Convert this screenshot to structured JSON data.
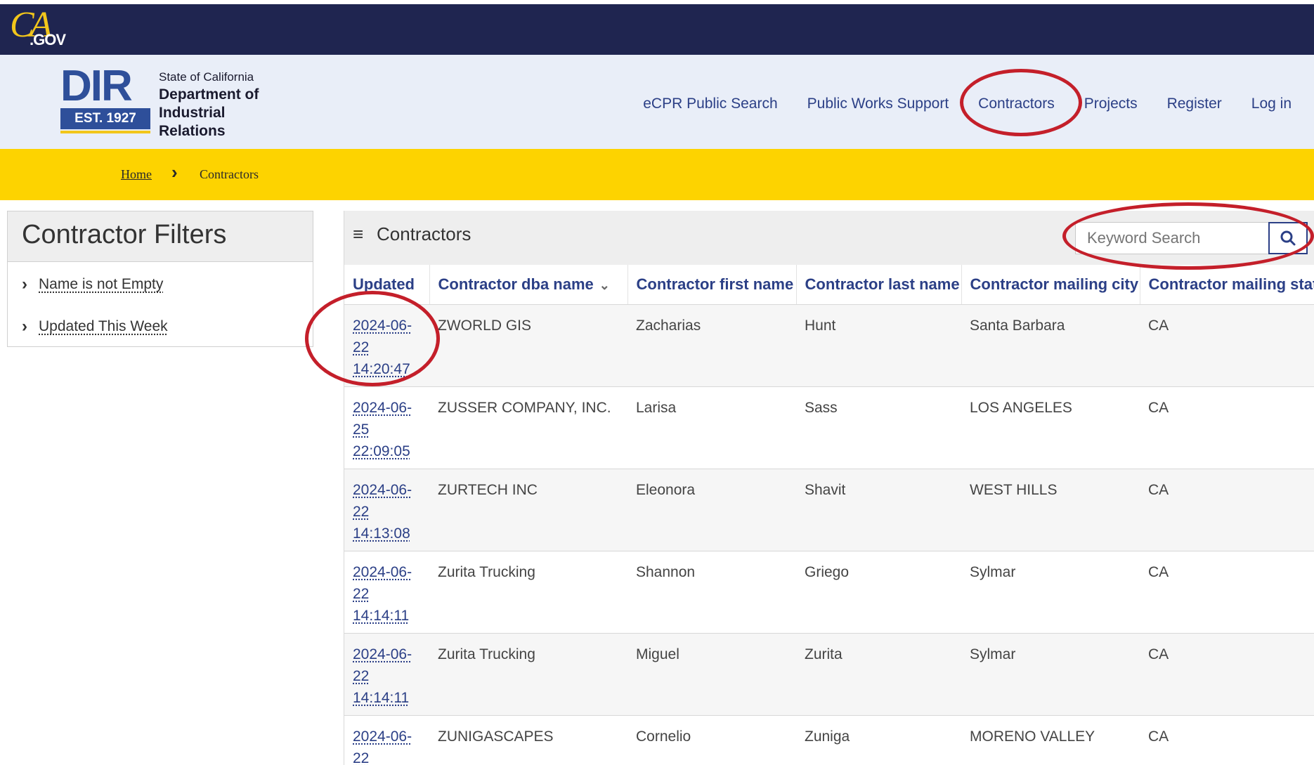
{
  "state_bar": {
    "ca_logo": "CA",
    "gov_logo": ".GOV"
  },
  "header": {
    "logo": {
      "dir": "DIR",
      "est": "EST. 1927",
      "line1": "State of California",
      "line2": "Department of",
      "line3": "Industrial Relations"
    },
    "nav": [
      {
        "label": "eCPR Public Search"
      },
      {
        "label": "Public Works Support"
      },
      {
        "label": "Contractors"
      },
      {
        "label": "Projects"
      },
      {
        "label": "Register"
      },
      {
        "label": "Log in"
      }
    ]
  },
  "breadcrumb": {
    "home": "Home",
    "separator": "›",
    "current": "Contractors"
  },
  "filters": {
    "title": "Contractor Filters",
    "items": [
      {
        "label": "Name is not Empty"
      },
      {
        "label": "Updated This Week"
      }
    ]
  },
  "panel": {
    "menu_icon": "≡",
    "title": "Contractors",
    "search_placeholder": "Keyword Search",
    "search_icon": "search-icon"
  },
  "table": {
    "columns": [
      "Updated",
      "Contractor dba name",
      "Contractor first name",
      "Contractor last name",
      "Contractor mailing city",
      "Contractor mailing state"
    ],
    "rows": [
      {
        "updated": "2024-06-22 14:20:47",
        "dba": "ZWORLD GIS",
        "first": "Zacharias",
        "last": "Hunt",
        "city": "Santa Barbara",
        "state": "CA"
      },
      {
        "updated": "2024-06-25 22:09:05",
        "dba": "ZUSSER COMPANY, INC.",
        "first": "Larisa",
        "last": "Sass",
        "city": "LOS ANGELES",
        "state": "CA"
      },
      {
        "updated": "2024-06-22 14:13:08",
        "dba": "ZURTECH INC",
        "first": "Eleonora",
        "last": "Shavit",
        "city": "WEST HILLS",
        "state": "CA"
      },
      {
        "updated": "2024-06-22 14:14:11",
        "dba": "Zurita Trucking",
        "first": "Shannon",
        "last": "Griego",
        "city": "Sylmar",
        "state": "CA"
      },
      {
        "updated": "2024-06-22 14:14:11",
        "dba": "Zurita Trucking",
        "first": "Miguel",
        "last": "Zurita",
        "city": "Sylmar",
        "state": "CA"
      },
      {
        "updated": "2024-06-22",
        "dba": "ZUNIGASCAPES",
        "first": "Cornelio",
        "last": "Zuniga",
        "city": "MORENO VALLEY",
        "state": "CA"
      }
    ]
  },
  "colors": {
    "state_bar": "#1f2550",
    "header_bg": "#e9eef8",
    "breadcrumb_bg": "#fdd300",
    "link": "#2b3f86",
    "annotation": "#c41f2a"
  }
}
